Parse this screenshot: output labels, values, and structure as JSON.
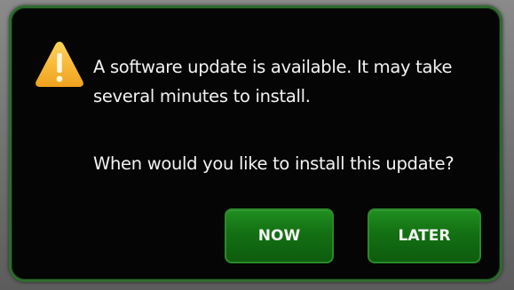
{
  "dialog": {
    "message": "A software update is available. It may take several minutes to install.",
    "question": "When would you like to install this update?",
    "icon": "warning-icon",
    "buttons": {
      "now_label": "NOW",
      "later_label": "LATER"
    }
  },
  "colors": {
    "dialog_background": "#050505",
    "dialog_border": "#2f6b2f",
    "button_green": "#137013",
    "warning_yellow": "#f5b431",
    "text": "#f2f2f2"
  }
}
